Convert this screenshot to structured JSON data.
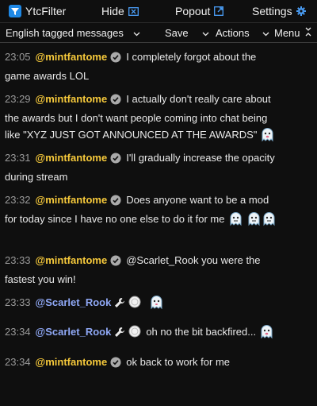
{
  "header": {
    "brand": "YtcFilter",
    "hide_label": "Hide",
    "popout_label": "Popout",
    "settings_label": "Settings",
    "accent": "#1e88e5"
  },
  "toolbar": {
    "filter_value": "English tagged messages",
    "save_label": "Save",
    "actions_label": "Actions",
    "menu_label": "Menu"
  },
  "colors": {
    "owner": "#f6c93b",
    "moderator": "#8fa8f5",
    "timestamp": "#9a9a9a"
  },
  "messages": [
    {
      "time": "23:05",
      "author": "@mintfantome",
      "text": "I completely forgot about the game awards LOL"
    },
    {
      "time": "23:29",
      "author": "@mintfantome",
      "text": "I actually don't really care about the awards but I don't want people coming into chat being like \"XYZ JUST GOT ANNOUNCED AT THE AWARDS\""
    },
    {
      "time": "23:31",
      "author": "@mintfantome",
      "text": "I'll gradually increase the opacity during stream"
    },
    {
      "time": "23:32",
      "author": "@mintfantome",
      "text": "Does anyone want to be a mod for today since I have no one else to do it for me"
    },
    {
      "time": "23:33",
      "author": "@mintfantome",
      "text": "@Scarlet_Rook you were the fastest you win!"
    },
    {
      "time": "23:33",
      "author": "@Scarlet_Rook",
      "text": ""
    },
    {
      "time": "23:34",
      "author": "@Scarlet_Rook",
      "text": "oh no the bit backfired..."
    },
    {
      "time": "23:34",
      "author": "@mintfantome",
      "text": "ok back to work for me"
    }
  ]
}
